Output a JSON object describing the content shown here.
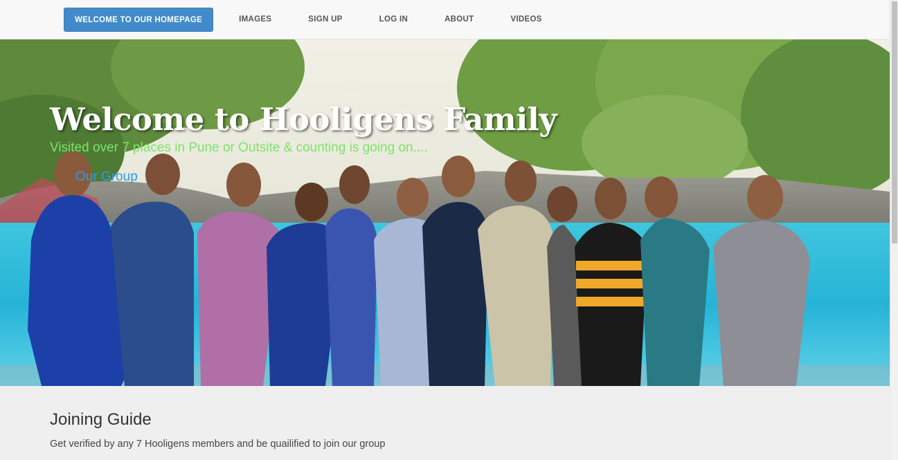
{
  "nav": {
    "items": [
      {
        "label": "WELCOME TO OUR HOMEPAGE",
        "active": true
      },
      {
        "label": "IMAGES"
      },
      {
        "label": "SIGN UP"
      },
      {
        "label": "LOG IN"
      },
      {
        "label": "ABOUT"
      },
      {
        "label": "VIDEOS"
      }
    ]
  },
  "hero": {
    "title": "Welcome to Hooligens Family",
    "subtitle": "Visited over 7 places in Pune or Outsite & counting is going on....",
    "link": "Our Group",
    "image_icon": "group-photo"
  },
  "content": {
    "heading": "Joining Guide",
    "text": "Get verified by any 7 Hooligens members and be quailified to join our group"
  },
  "colors": {
    "accent": "#428bca",
    "subtitle": "#7de36a",
    "link": "#2b9cf0"
  }
}
